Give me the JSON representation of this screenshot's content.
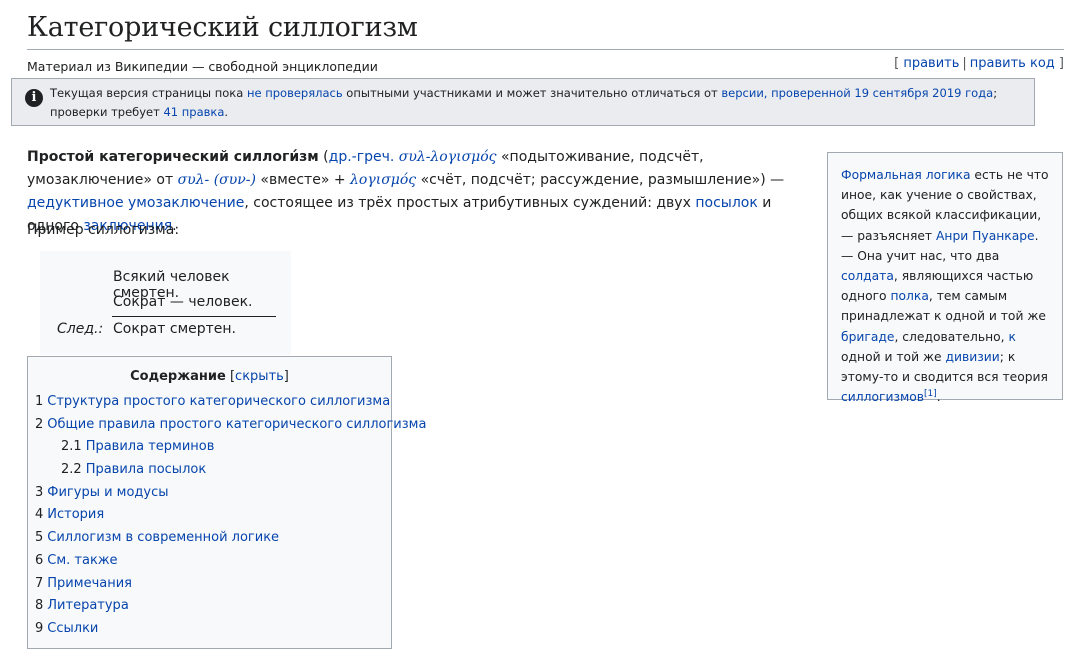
{
  "header": {
    "title": "Категорический силлогизм",
    "site_sub": "Материал из Википедии — свободной энциклопедии",
    "edit": "править",
    "edit_code": "править код"
  },
  "notice": {
    "t1": "Текущая версия страницы пока ",
    "l1": "не проверялась",
    "t2": " опытными участниками и может значительно отличаться от ",
    "l2": "версии, проверенной 19 сентября 2019 года",
    "t3": "; проверки требует ",
    "l3": "41 правка",
    "t4": "."
  },
  "lead": {
    "bold": "Простой категорический силлоги́зм",
    "p1": " (",
    "l_lang": "др.-греч.",
    "sp1": " ",
    "greek1": "συλ-λογισμός",
    "p2": " «подытоживание, подсчёт, умозаключение» от ",
    "greek2": "συλ-",
    "p3": " ",
    "greek3": "(συν-)",
    "p4": " «вместе» + ",
    "greek4": "λογισμός",
    "p5": " «счёт, подсчёт; рассуждение, размышление») — ",
    "l_ded": "дедуктивное умозаключение",
    "p6": ", состоящее из трёх простых атрибутивных суждений: двух ",
    "l_pos": "посылок",
    "p7": " и одного ",
    "l_zak": "заключения",
    "p8": "."
  },
  "example": {
    "label": "Пример силлогизма:",
    "line1": "Всякий человек смертен.",
    "line2": "Сократ — человек.",
    "sled": "След.:",
    "line3": "Сократ смертен."
  },
  "toc": {
    "title": "Содержание",
    "open": "[",
    "hide": "скрыть",
    "close": "]",
    "items": [
      {
        "num": "1",
        "label": "Структура простого категорического силлогизма"
      },
      {
        "num": "2",
        "label": "Общие правила простого категорического силлогизма"
      },
      {
        "num": "2.1",
        "label": "Правила терминов"
      },
      {
        "num": "2.2",
        "label": "Правила посылок"
      },
      {
        "num": "3",
        "label": "Фигуры и модусы"
      },
      {
        "num": "4",
        "label": "История"
      },
      {
        "num": "5",
        "label": "Силлогизм в современной логике"
      },
      {
        "num": "6",
        "label": "См. также"
      },
      {
        "num": "7",
        "label": "Примечания"
      },
      {
        "num": "8",
        "label": "Литература"
      },
      {
        "num": "9",
        "label": "Ссылки"
      }
    ]
  },
  "quote": {
    "l1": "Формальная логика",
    "t1": " есть не что иное, как учение о свойствах, общих всякой классификации, — разъясняет ",
    "l2": "Анри Пуанкаре",
    "t2": ". — Она учит нас, что два ",
    "l3": "солдата",
    "t3": ", являющихся частью одного ",
    "l4": "полка",
    "t4": ", тем самым принадлежат к одной и той же ",
    "l5": "бригаде",
    "t5": ", следовательно, ",
    "l6": "к",
    "t6": " одной и той же ",
    "l7": "дивизии",
    "t7": "; к этому-то и сводится вся теория ",
    "l8": "силлогизмов",
    "ref": "[1]",
    "t8": "."
  },
  "colors": {
    "link": "#0645ad",
    "notice_bg": "#eaecf0",
    "box_bg": "#f8f9fa",
    "border": "#a2a9b1"
  }
}
